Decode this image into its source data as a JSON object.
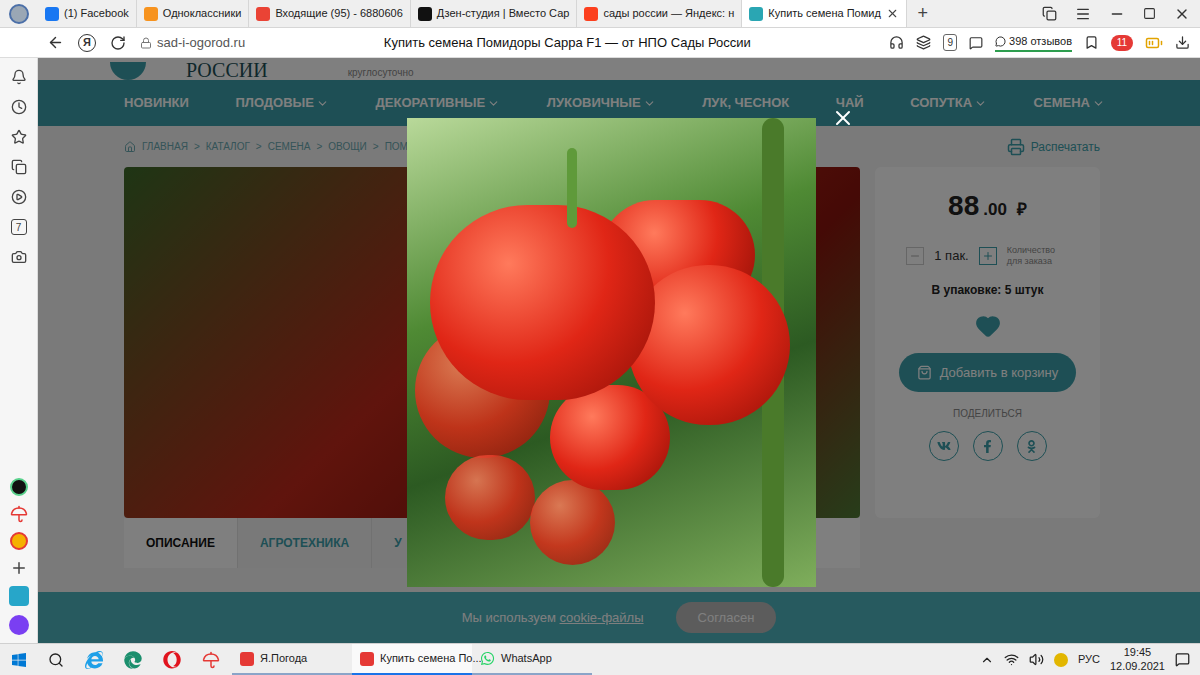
{
  "browser": {
    "tabs": [
      {
        "label": "(1) Facebook",
        "selected": false,
        "color": "#1877f2"
      },
      {
        "label": "Одноклассники",
        "selected": false,
        "color": "#f7931e"
      },
      {
        "label": "Входящие (95) - 6880606",
        "selected": false,
        "color": "#ea4335"
      },
      {
        "label": "Дзен-студия | Вместо Сар",
        "selected": false,
        "color": "#111111"
      },
      {
        "label": "сады россии — Яндекс: н",
        "selected": false,
        "color": "#fc3f1d"
      },
      {
        "label": "Купить семена Помид",
        "selected": true,
        "color": "#2aa6b3"
      }
    ],
    "new_tab": "+",
    "yandex": "Я",
    "address": "sad-i-ogorod.ru",
    "page_title": "Купить семена Помидоры Сарра F1 — от НПО Сады России",
    "reader_badge": "9",
    "reviews": "398 отзывов",
    "notifications": "11",
    "sidebar_counter": "7"
  },
  "site": {
    "logo": "РОССИИ",
    "tagline": "круглосуточно",
    "nav": [
      {
        "label": "НОВИНКИ",
        "dropdown": false
      },
      {
        "label": "ПЛОДОВЫЕ",
        "dropdown": true
      },
      {
        "label": "ДЕКОРАТИВНЫЕ",
        "dropdown": true
      },
      {
        "label": "ЛУКОВИЧНЫЕ",
        "dropdown": true
      },
      {
        "label": "ЛУК, ЧЕСНОК",
        "dropdown": false
      },
      {
        "label": "ЧАЙ",
        "dropdown": false
      },
      {
        "label": "СОПУТКА",
        "dropdown": true
      },
      {
        "label": "СЕМЕНА",
        "dropdown": true
      }
    ],
    "breadcrumbs": [
      "ГЛАВНАЯ",
      "КАТАЛОГ",
      "СЕМЕНА",
      "ОВОЩИ",
      "ПОМ"
    ],
    "breadcrumb_separator": ">",
    "print": "Распечатать",
    "price": {
      "integer": "88",
      "fraction": ".00",
      "currency": "₽"
    },
    "quantity": {
      "value": "1 пак.",
      "label": "Количество для заказа"
    },
    "package": "В упаковке: 5 штук",
    "add_to_cart": "Добавить в корзину",
    "share": "ПОДЕЛИТЬСЯ",
    "product_tabs": [
      {
        "label": "ОПИСАНИЕ",
        "selected": true
      },
      {
        "label": "АГРОТЕХНИКА",
        "selected": false
      },
      {
        "label": "У",
        "selected": false
      }
    ],
    "cookie": {
      "text": "Мы используем",
      "link": "cookie-файлы",
      "button": "Согласен"
    }
  },
  "taskbar": {
    "apps": [
      {
        "label": "Я.Погода",
        "selected": false,
        "color": "#e53935"
      },
      {
        "label": "Купить семена По...",
        "selected": true,
        "color": "#e53935"
      },
      {
        "label": "WhatsApp",
        "selected": false,
        "color": "#25d366"
      }
    ],
    "language": "РУС",
    "time": "19:45",
    "date": "12.09.2021"
  }
}
